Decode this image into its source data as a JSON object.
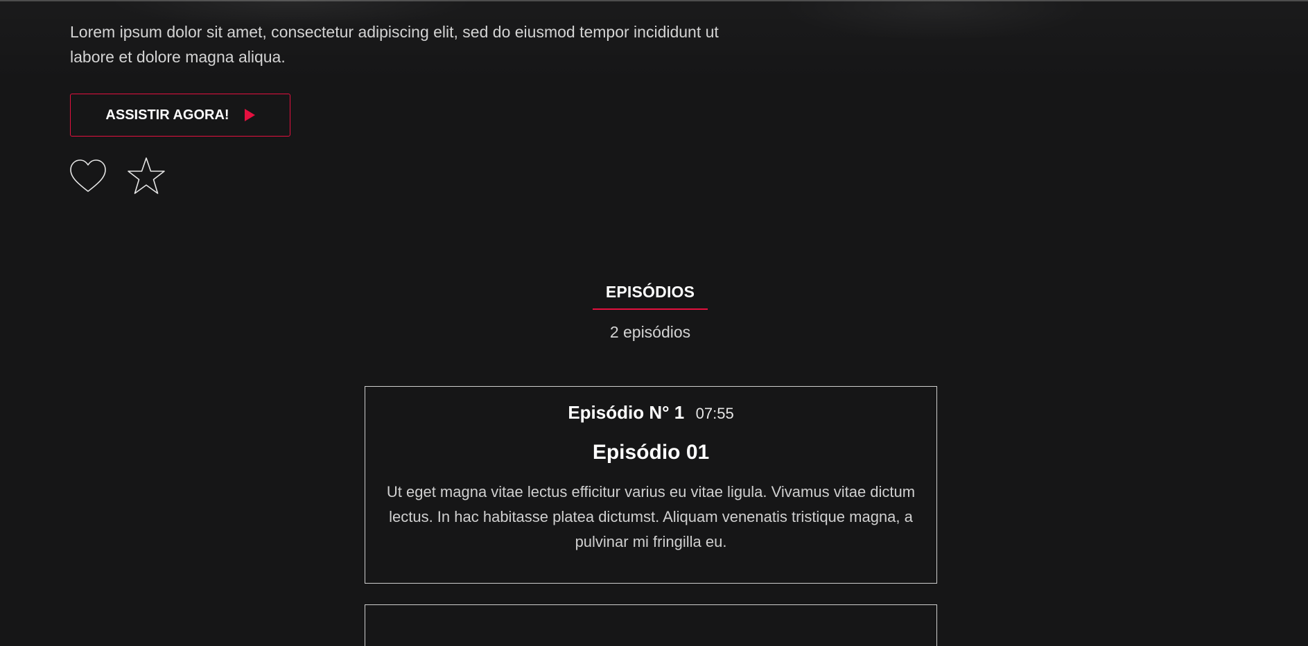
{
  "hero": {
    "description": "Lorem ipsum dolor sit amet, consectetur adipiscing elit, sed do eiusmod tempor incididunt ut labore et dolore magna aliqua.",
    "watch_button_label": "ASSISTIR AGORA!",
    "icons": {
      "play": "play-icon",
      "favorite": "heart-icon",
      "rate": "star-icon"
    }
  },
  "episodes": {
    "title": "EPISÓDIOS",
    "count_label": "2 episódios",
    "items": [
      {
        "number_label": "Episódio N° 1",
        "duration": "07:55",
        "title": "Episódio 01",
        "description": "Ut eget magna vitae lectus efficitur varius eu vitae ligula. Vivamus vitae dictum lectus. In hac habitasse platea dictumst. Aliquam venenatis tristique magna, a pulvinar mi fringilla eu."
      }
    ]
  },
  "colors": {
    "background": "#161617",
    "accent": "#e5103f",
    "text": "#d4d4d4",
    "card_border": "#cfcfcf"
  }
}
